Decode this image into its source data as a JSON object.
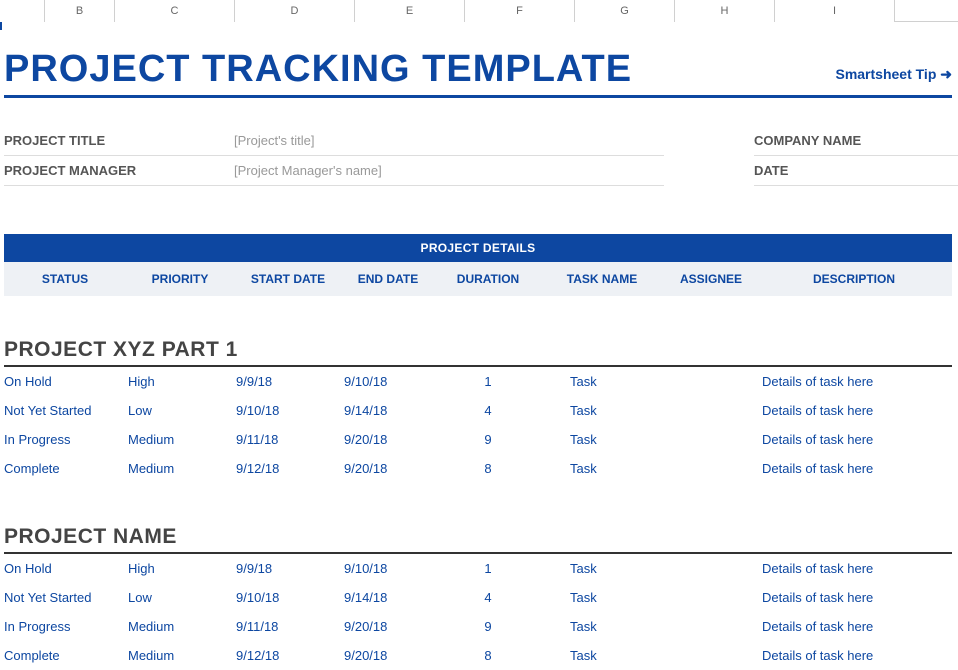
{
  "column_letters": [
    "",
    "B",
    "C",
    "D",
    "E",
    "F",
    "G",
    "H",
    "I"
  ],
  "title": "PROJECT TRACKING TEMPLATE",
  "tip": "Smartsheet Tip ➜",
  "meta": {
    "project_title_label": "PROJECT TITLE",
    "project_title_value": "[Project's title]",
    "project_manager_label": "PROJECT MANAGER",
    "project_manager_value": "[Project Manager's name]",
    "company_name_label": "COMPANY NAME",
    "date_label": "DATE"
  },
  "details_banner": "PROJECT DETAILS",
  "headers": {
    "status": "STATUS",
    "priority": "PRIORITY",
    "start": "START DATE",
    "end": "END DATE",
    "duration": "DURATION",
    "task": "TASK NAME",
    "assignee": "ASSIGNEE",
    "description": "DESCRIPTION"
  },
  "sections": [
    {
      "name": "PROJECT XYZ PART 1",
      "rows": [
        {
          "status": "On Hold",
          "priority": "High",
          "start": "9/9/18",
          "end": "9/10/18",
          "duration": "1",
          "task": "Task",
          "assignee": "",
          "description": "Details of task here"
        },
        {
          "status": "Not Yet Started",
          "priority": "Low",
          "start": "9/10/18",
          "end": "9/14/18",
          "duration": "4",
          "task": "Task",
          "assignee": "",
          "description": "Details of task here"
        },
        {
          "status": "In Progress",
          "priority": "Medium",
          "start": "9/11/18",
          "end": "9/20/18",
          "duration": "9",
          "task": "Task",
          "assignee": "",
          "description": "Details of task here"
        },
        {
          "status": "Complete",
          "priority": "Medium",
          "start": "9/12/18",
          "end": "9/20/18",
          "duration": "8",
          "task": "Task",
          "assignee": "",
          "description": "Details of task here"
        }
      ]
    },
    {
      "name": "PROJECT NAME",
      "rows": [
        {
          "status": "On Hold",
          "priority": "High",
          "start": "9/9/18",
          "end": "9/10/18",
          "duration": "1",
          "task": "Task",
          "assignee": "",
          "description": "Details of task here"
        },
        {
          "status": "Not Yet Started",
          "priority": "Low",
          "start": "9/10/18",
          "end": "9/14/18",
          "duration": "4",
          "task": "Task",
          "assignee": "",
          "description": "Details of task here"
        },
        {
          "status": "In Progress",
          "priority": "Medium",
          "start": "9/11/18",
          "end": "9/20/18",
          "duration": "9",
          "task": "Task",
          "assignee": "",
          "description": "Details of task here"
        },
        {
          "status": "Complete",
          "priority": "Medium",
          "start": "9/12/18",
          "end": "9/20/18",
          "duration": "8",
          "task": "Task",
          "assignee": "",
          "description": "Details of task here"
        }
      ]
    }
  ]
}
